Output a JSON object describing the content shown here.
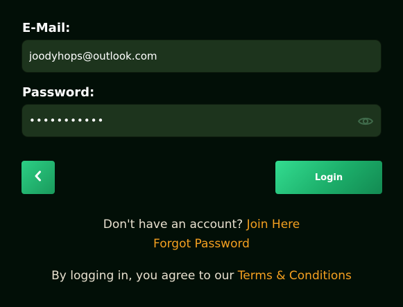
{
  "form": {
    "email_label": "E-Mail:",
    "email_value": "joodyhops@outlook.com",
    "password_label": "Password:",
    "password_value": "•••••••••••",
    "login_label": "Login"
  },
  "icons": {
    "back": "chevron-left-icon",
    "password_toggle": "eye-icon"
  },
  "footer": {
    "no_account_text": "Don't have an account?",
    "join_link": "Join Here",
    "forgot_link": "Forgot Password",
    "terms_prefix": "By logging in, you agree to our",
    "terms_link": "Terms & Conditions"
  },
  "colors": {
    "background": "#020f07",
    "input_background": "#1d341d",
    "accent_green": "#2ccf85",
    "link_orange": "#f5a020"
  }
}
